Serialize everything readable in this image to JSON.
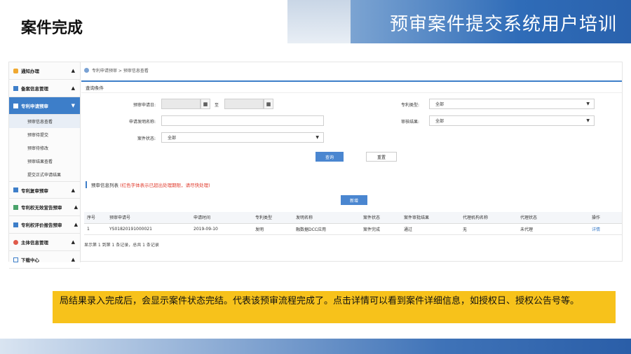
{
  "slide": {
    "title": "案件完成",
    "banner": "预审案件提交系统用户培训",
    "callout": "局结果录入完成后，会显示案件状态完结。代表该预审流程完成了。点击详情可以看到案件详细信息，如授权日、授权公告号等。"
  },
  "sidebar": {
    "groups": [
      {
        "label": "通知办理",
        "chevron": "▲"
      },
      {
        "label": "备案信息管理",
        "chevron": "▲"
      },
      {
        "label": "专利申请预审",
        "chevron": "▼"
      },
      {
        "label": "专利复审预审",
        "chevron": "▲"
      },
      {
        "label": "专利权无效宣告预审",
        "chevron": "▲"
      },
      {
        "label": "专利权评价报告预审",
        "chevron": "▲"
      },
      {
        "label": "主体信息管理",
        "chevron": "▲"
      },
      {
        "label": "下载中心",
        "chevron": "▲"
      }
    ],
    "sub_items": [
      "预审信息查看",
      "预审待提交",
      "预审待修改",
      "预审结果查看",
      "提交正式申请结果"
    ]
  },
  "breadcrumb": "专利申请预审 > 预审信息查看",
  "query": {
    "title": "查询条件",
    "date_label": "预审申请日:",
    "date_sep": "至",
    "name_label": "申请发明名称:",
    "status_label": "案件状态:",
    "status_value": "全部",
    "type_label": "专利类型:",
    "type_value": "全部",
    "result_label": "审核结果:",
    "result_value": "全部",
    "search_btn": "查询",
    "reset_btn": "重置"
  },
  "list": {
    "title": "预审信息列表",
    "warning": "(红色字体表示已超出处理期限，请尽快处理)",
    "new_btn": "新增",
    "headers": [
      "序号",
      "预审申请号",
      "申请时间",
      "专利类型",
      "发明名称",
      "案件状态",
      "案件审批结果",
      "代理机构名称",
      "代理状态",
      "操作"
    ],
    "rows": [
      [
        "1",
        "YS01820191000021",
        "2019-09-10",
        "发明",
        "融数据DCC应用",
        "案件完成",
        "通过",
        "无",
        "未代理",
        "详情"
      ]
    ],
    "footer": "显示第 1 到第 1 条记录，总共 1 条记录"
  },
  "colors": {
    "accent": "#3d7ec9",
    "callout": "#f7c21b",
    "warning": "#e03a2c"
  },
  "icons": {
    "calendar": "calendar-icon",
    "bell": "bell-icon",
    "user": "user-icon"
  }
}
